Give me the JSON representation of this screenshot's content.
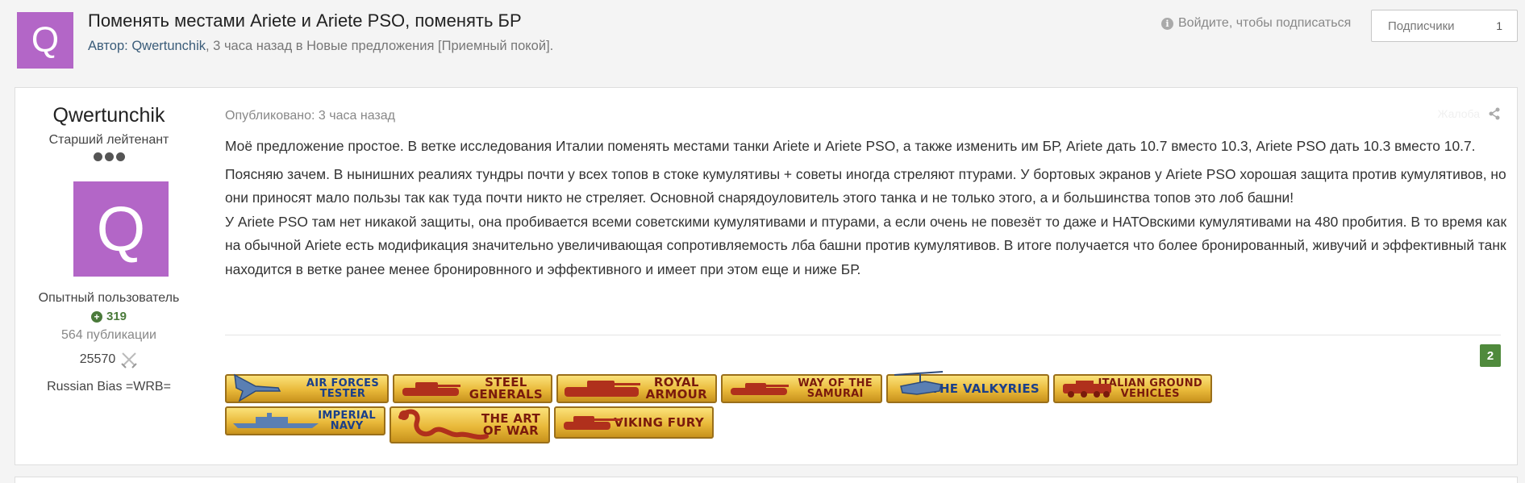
{
  "topic": {
    "avatar_letter": "Q",
    "title": "Поменять местами Ariete и Ariete PSO, поменять БР",
    "meta_author_label": "Автор: ",
    "meta_author": "Qwertunchik",
    "meta_rest": ", 3 часа назад в Новые предложения [Приемный покой]."
  },
  "follow": {
    "hint": "Войдите, чтобы подписаться",
    "button_label": "Подписчики",
    "count": "1"
  },
  "author": {
    "name": "Qwertunchik",
    "rank": "Старший лейтенант",
    "avatar_letter": "Q",
    "group": "Опытный пользователь",
    "reputation": "319",
    "posts": "564 публикации",
    "score": "25570",
    "signature_tag": "Russian Bias =WRB="
  },
  "post": {
    "date": "Опубликовано: 3 часа назад",
    "report": "Жалоба",
    "paragraphs": [
      "Моё предложение простое. В ветке исследования Италии поменять местами танки Ariete и Ariete PSO, а также изменить им БР, Ariete дать 10.7 вместо 10.3, Ariete PSO дать 10.3 вместо 10.7.",
      "Поясняю зачем. В нынишних реалиях тундры почти у всех топов в стоке кумулятивы + советы иногда стреляют птурами. У бортовых экранов у Ariete PSO хорошая защита против кумулятивов, но они приносят мало пользы так как туда почти никто не стреляет. Основной снарядоуловитель этого танка и не только этого, а и большинства топов это лоб башни!",
      "У Ariete PSO там нет никакой защиты, она пробивается всеми советскими кумулятивами и птурами, а если очень не повезёт то даже и НАТОвскими кумулятивами на 480 пробития. В то время как на обычной Ariete есть модификация значительно увеличивающая сопротивляемость лба башни против кумулятивов. В итоге получается что более бронированный, живучий и эффективный танк находится в ветке ранее менее бронировнного и эффективного и имеет при этом еще и ниже БР."
    ],
    "like_count": "2"
  },
  "awards": [
    {
      "line1": "Air Forces",
      "line2": "Tester",
      "icon": "plane-icon"
    },
    {
      "line1": "Steel",
      "line2": "Generals",
      "icon": "tank-icon"
    },
    {
      "line1": "Royal",
      "line2": "Armour",
      "icon": "tank-icon"
    },
    {
      "line1": "Way of the",
      "line2": "Samurai",
      "icon": "tank-icon"
    },
    {
      "line1": "The Valkyries",
      "line2": "",
      "icon": "helicopter-icon"
    },
    {
      "line1": "Italian Ground",
      "line2": "Vehicles",
      "icon": "armored-car-icon"
    },
    {
      "line1": "Imperial",
      "line2": "Navy",
      "icon": "ship-icon"
    },
    {
      "line1": "The Art",
      "line2": "of War",
      "icon": "dragon-icon"
    },
    {
      "line1": "Viking Fury",
      "line2": "",
      "icon": "tank-icon"
    }
  ],
  "colors": {
    "avatar": "#b366c7",
    "reputation": "#4a7a3a",
    "award_gold": "#e9b93a",
    "award_text_red": "#7a1a0c",
    "award_text_blue": "#1a3f8a"
  }
}
